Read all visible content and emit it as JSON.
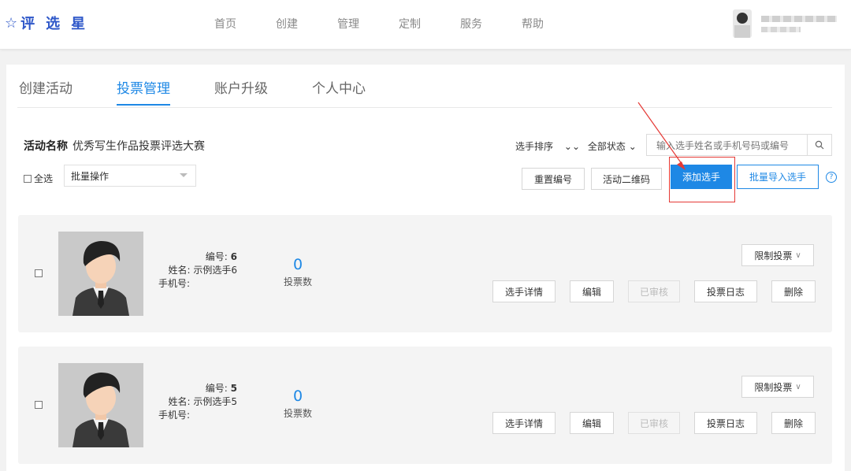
{
  "brand": {
    "name": "评选星"
  },
  "nav": [
    "首页",
    "创建",
    "管理",
    "定制",
    "服务",
    "帮助"
  ],
  "tabs": [
    {
      "label": "创建活动",
      "active": false
    },
    {
      "label": "投票管理",
      "active": true
    },
    {
      "label": "账户升级",
      "active": false
    },
    {
      "label": "个人中心",
      "active": false
    }
  ],
  "activity": {
    "label": "活动名称",
    "name": "优秀写生作品投票评选大赛"
  },
  "filters": {
    "sort": "选手排序",
    "status": "全部状态"
  },
  "search": {
    "placeholder": "输入选手姓名或手机号码或编号"
  },
  "select_all": "全选",
  "batch": {
    "value": "批量操作"
  },
  "toolbar": {
    "renumber": "重置编号",
    "qrcode": "活动二维码",
    "add": "添加选手",
    "import": "批量导入选手"
  },
  "contestants": [
    {
      "id_label": "编号:",
      "id": "6",
      "name_label": "姓名:",
      "name": "示例选手6",
      "phone_label": "手机号:",
      "phone": "",
      "votes": "0",
      "votes_label": "投票数",
      "limit": "限制投票",
      "details": "选手详情",
      "edit": "编辑",
      "reviewed": "已审核",
      "log": "投票日志",
      "delete": "删除"
    },
    {
      "id_label": "编号:",
      "id": "5",
      "name_label": "姓名:",
      "name": "示例选手5",
      "phone_label": "手机号:",
      "phone": "",
      "votes": "0",
      "votes_label": "投票数",
      "limit": "限制投票",
      "details": "选手详情",
      "edit": "编辑",
      "reviewed": "已审核",
      "log": "投票日志",
      "delete": "删除"
    }
  ],
  "colors": {
    "accent": "#1e88e5",
    "brand": "#2f58c9",
    "highlight": "#e53935"
  }
}
